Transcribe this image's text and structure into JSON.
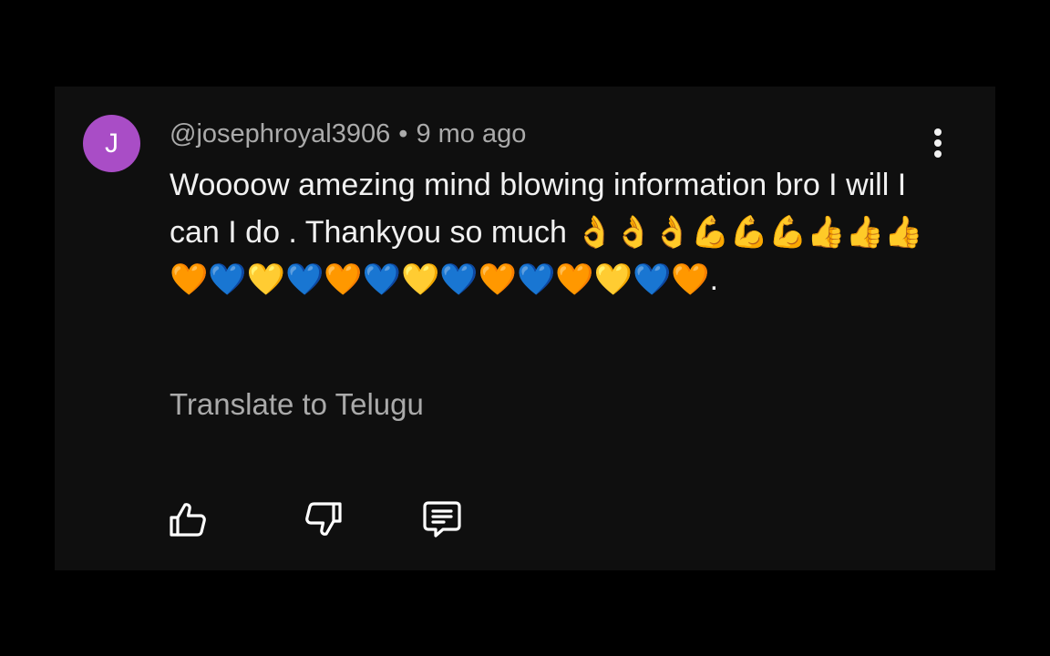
{
  "comment": {
    "avatar_initial": "J",
    "avatar_color": "#a94dc6",
    "author": "@josephroyal3906",
    "separator": "•",
    "time_ago": "9 mo ago",
    "text": "Woooow amezing mind blowing information bro I will I can I do . Thankyou so much 👌👌👌💪💪💪👍👍👍🧡💙💛💙🧡💙💛💙🧡💙🧡💛💙🧡.",
    "translate_label": "Translate to Telugu",
    "more_icon": "more-vertical-icon"
  },
  "actions": {
    "like_icon": "thumbs-up-icon",
    "dislike_icon": "thumbs-down-icon",
    "reply_icon": "comment-reply-icon"
  },
  "colors": {
    "background": "#000000",
    "card": "#0f0f0f",
    "primary_text": "#f1f1f1",
    "secondary_text": "#aaaaaa"
  }
}
